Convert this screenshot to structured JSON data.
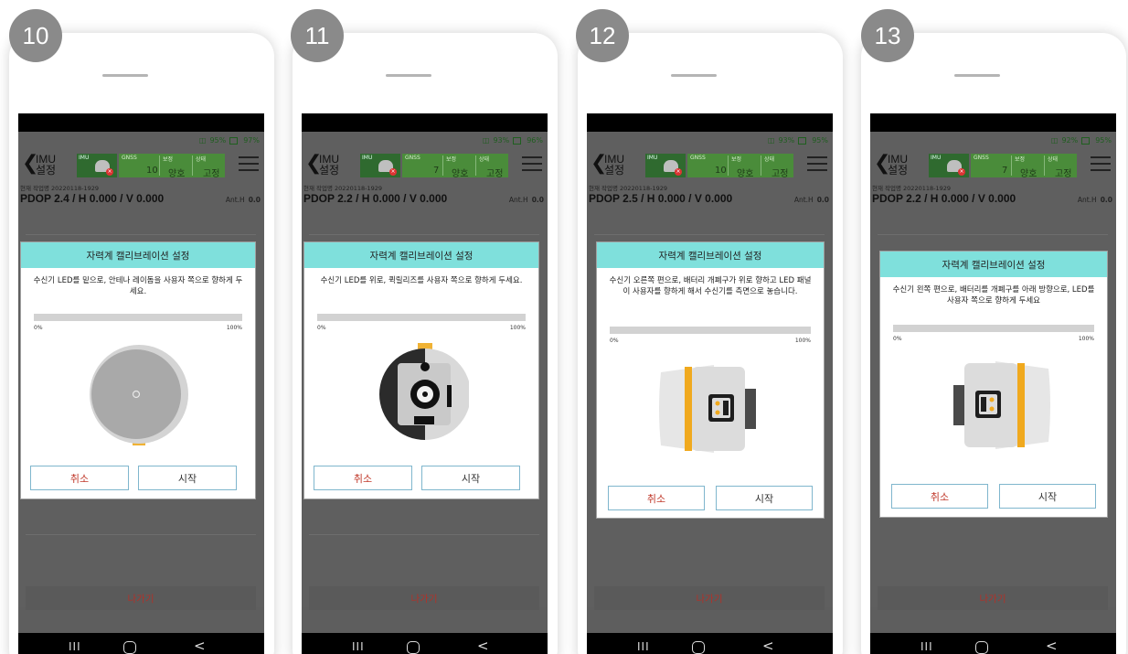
{
  "colors": {
    "accent_title": "#7fe0dc",
    "cancel_text": "#c0392b",
    "exit_text": "#b0322a",
    "gnss_box": "#4a8c3a",
    "imu_box": "#2f6a2f"
  },
  "common": {
    "title_line1": "IMU",
    "title_line2": "설정",
    "imu_label": "IMU",
    "gnss_label": "GNSS",
    "boost_label": "보정",
    "status_label": "상태",
    "boost_value": "양호",
    "status_value": "고정",
    "job_label": "현재 작업명 20220118-1929",
    "anth_label": "Ant.H",
    "anth_value": "0.0",
    "dialog_title": "자력계 캘리브레이션 설정",
    "progress_start": "0%",
    "progress_end": "100%",
    "progress_value": 0,
    "cancel_label": "취소",
    "start_label": "시작",
    "exit_label": "나가기",
    "nav_recent": "III",
    "nav_back": "<"
  },
  "phones": [
    {
      "step": "10",
      "batt_left": "95%",
      "batt_right": "97%",
      "gnss_count": "10",
      "pdop": "PDOP 2.4 / H 0.000 / V 0.000",
      "message": "수신기 LED를 밑으로, 안테나 레이돔을 사용자 쪽으로 향하게 두세요.",
      "device_view": "bottom-view",
      "icons": "receiver-bottom-view-icon"
    },
    {
      "step": "11",
      "batt_left": "93%",
      "batt_right": "96%",
      "gnss_count": "7",
      "pdop": "PDOP 2.2 / H 0.000 / V 0.000",
      "message": "수신기 LED를 위로, 퀵릴리즈를 사용자 쪽으로 향하게 두세요.",
      "device_view": "quick-release-view",
      "icons": "receiver-quick-release-icon"
    },
    {
      "step": "12",
      "batt_left": "93%",
      "batt_right": "95%",
      "gnss_count": "10",
      "pdop": "PDOP 2.5 / H 0.000 / V 0.000",
      "message": "수신기 오른쪽 편으로, 배터리 개폐구가 위로 향하고 LED 패널이 사용자를 향하게 해서 수신기를 측면으로 놓습니다.",
      "device_view": "right-side-view",
      "icons": "receiver-right-side-icon"
    },
    {
      "step": "13",
      "batt_left": "92%",
      "batt_right": "95%",
      "gnss_count": "7",
      "pdop": "PDOP 2.2 / H 0.000 / V 0.000",
      "message": "수신기 왼쪽 편으로, 배터리를 개폐구를 아래 방향으로, LED를 사용자 쪽으로 향하게 두세요",
      "device_view": "left-side-view",
      "icons": "receiver-left-side-icon"
    }
  ]
}
